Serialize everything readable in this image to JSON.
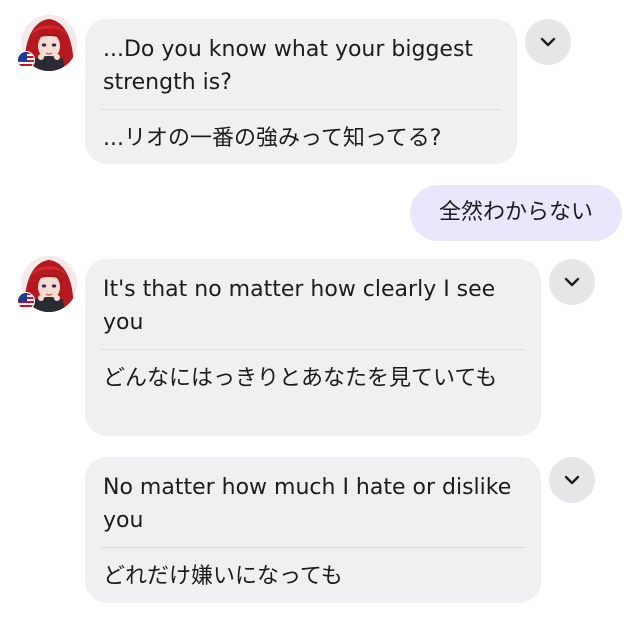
{
  "messages": [
    {
      "role": "assistant",
      "english": "...Do you know what your biggest strength is?",
      "japanese": "...リオの一番の強みって知ってる?",
      "flag_icon": "us-flag-icon",
      "expand_icon": "chevron-down-icon"
    },
    {
      "role": "user",
      "text": "全然わからない"
    },
    {
      "role": "assistant",
      "english": "It's that no matter how clearly I see you",
      "japanese": "どんなにはっきりとあなたを見ていても",
      "flag_icon": "us-flag-icon",
      "expand_icon": "chevron-down-icon"
    },
    {
      "role": "assistant",
      "english": "No matter how much I hate or dislike you",
      "japanese": "どれだけ嫌いになっても",
      "expand_icon": "chevron-down-icon"
    }
  ],
  "colors": {
    "assistant_bubble": "#f0f0f2",
    "user_bubble": "#e8e7fb",
    "chevron_button": "#e6e6e9"
  }
}
